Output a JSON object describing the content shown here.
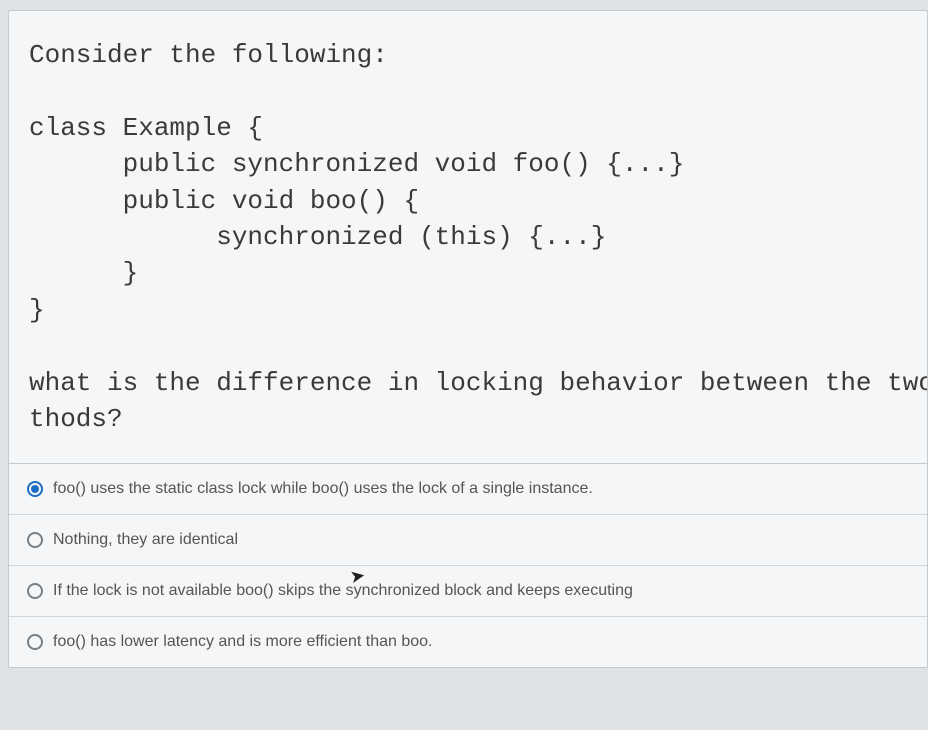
{
  "question": {
    "intro": "Consider the following:",
    "code": "class Example {\n      public synchronized void foo() {...}\n      public void boo() {\n            synchronized (this) {...}\n      }\n}",
    "prompt_line1": "what is the difference in locking behavior between the two me",
    "prompt_line2": "thods?"
  },
  "options": [
    {
      "id": "opt-a",
      "label": "foo() uses the static class lock while boo() uses the lock of a single instance.",
      "selected": true
    },
    {
      "id": "opt-b",
      "label": "Nothing, they are identical",
      "selected": false
    },
    {
      "id": "opt-c",
      "label": "If the lock is not available boo() skips the synchronized block and keeps executing",
      "selected": false
    },
    {
      "id": "opt-d",
      "label": "foo() has lower latency and is more efficient than boo.",
      "selected": false
    }
  ]
}
